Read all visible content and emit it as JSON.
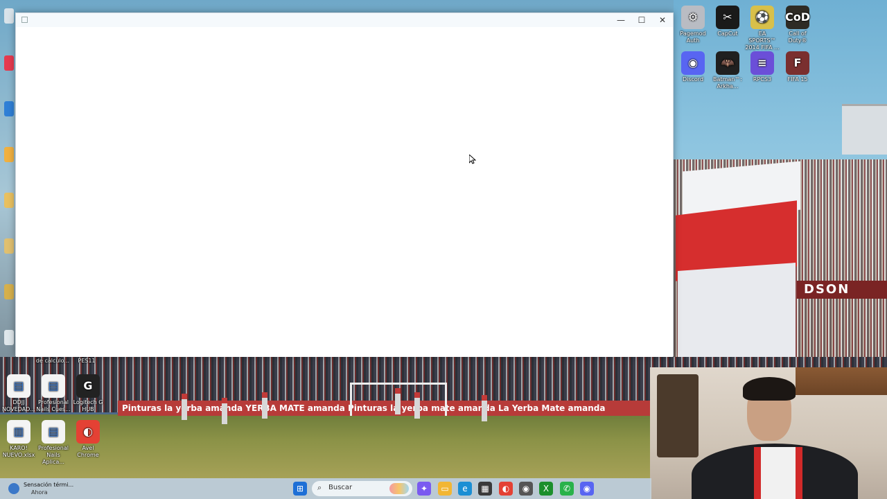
{
  "desktop": {
    "right_icons": [
      {
        "label": "Pagemod\nAuth",
        "color": "#b9bcc3",
        "glyph": "⚙"
      },
      {
        "label": "CapCut",
        "color": "#1a1a1a",
        "glyph": "✂"
      },
      {
        "label": "EA SPORTS™ 2014 FIFA ...",
        "color": "#d8c04a",
        "glyph": "⚽"
      },
      {
        "label": "Call of Duty®",
        "color": "#2e2b25",
        "glyph": "CoD"
      },
      {
        "label": "Discord",
        "color": "#5865f2",
        "glyph": "◉"
      },
      {
        "label": "Batman™: Arkha...",
        "color": "#202020",
        "glyph": "🦇"
      },
      {
        "label": "RPCS3",
        "color": "#6b4fd8",
        "glyph": "≡"
      },
      {
        "label": "FIFA 15",
        "color": "#7a2f2f",
        "glyph": "F"
      }
    ],
    "bottom_icons": [
      {
        "label": "DDJJ NOVEDAD...",
        "color": "#f4f4f4",
        "glyph": "▤"
      },
      {
        "label": "Profesional Nails Cues...",
        "color": "#f4f4f4",
        "glyph": "▤"
      },
      {
        "label": "Logitech G HUB",
        "color": "#222",
        "glyph": "G"
      },
      {
        "label": "KARO! NUEVO.xlsx",
        "color": "#f4f4f4",
        "glyph": "▥"
      },
      {
        "label": "Profesional Nails Aplica...",
        "color": "#f4f4f4",
        "glyph": "▤"
      },
      {
        "label": "Avel Chrome",
        "color": "#e44134",
        "glyph": "◐"
      }
    ],
    "above_bottom_labels": [
      "de cálculo...",
      "PES11"
    ],
    "stadium_banner": "DSON",
    "adboard_text": "Pinturas  la yerba  amanda  YERBA MATE  amanda  Pinturas  la yerba mate  amanda  La Yerba Mate  amanda"
  },
  "window": {
    "title": "",
    "controls": {
      "minimize": "—",
      "maximize": "☐",
      "close": "✕"
    }
  },
  "taskbar": {
    "weather_title": "Sensación térmi...",
    "weather_sub": "Ahora",
    "search_placeholder": "Buscar",
    "apps": [
      {
        "name": "start",
        "glyph": "⊞",
        "color": "#1d6fd6"
      },
      {
        "name": "copilot",
        "glyph": "✦",
        "color": "#7a5af0"
      },
      {
        "name": "explorer",
        "glyph": "▭",
        "color": "#f2b634"
      },
      {
        "name": "edge",
        "glyph": "e",
        "color": "#1b8fd4"
      },
      {
        "name": "store",
        "glyph": "▦",
        "color": "#3a3a3a"
      },
      {
        "name": "chrome",
        "glyph": "◐",
        "color": "#e44134"
      },
      {
        "name": "capture",
        "glyph": "◉",
        "color": "#555"
      },
      {
        "name": "xbox",
        "glyph": "X",
        "color": "#1c8f2c"
      },
      {
        "name": "whatsapp",
        "glyph": "✆",
        "color": "#29b24a"
      },
      {
        "name": "discord",
        "glyph": "◉",
        "color": "#5865f2"
      }
    ]
  }
}
